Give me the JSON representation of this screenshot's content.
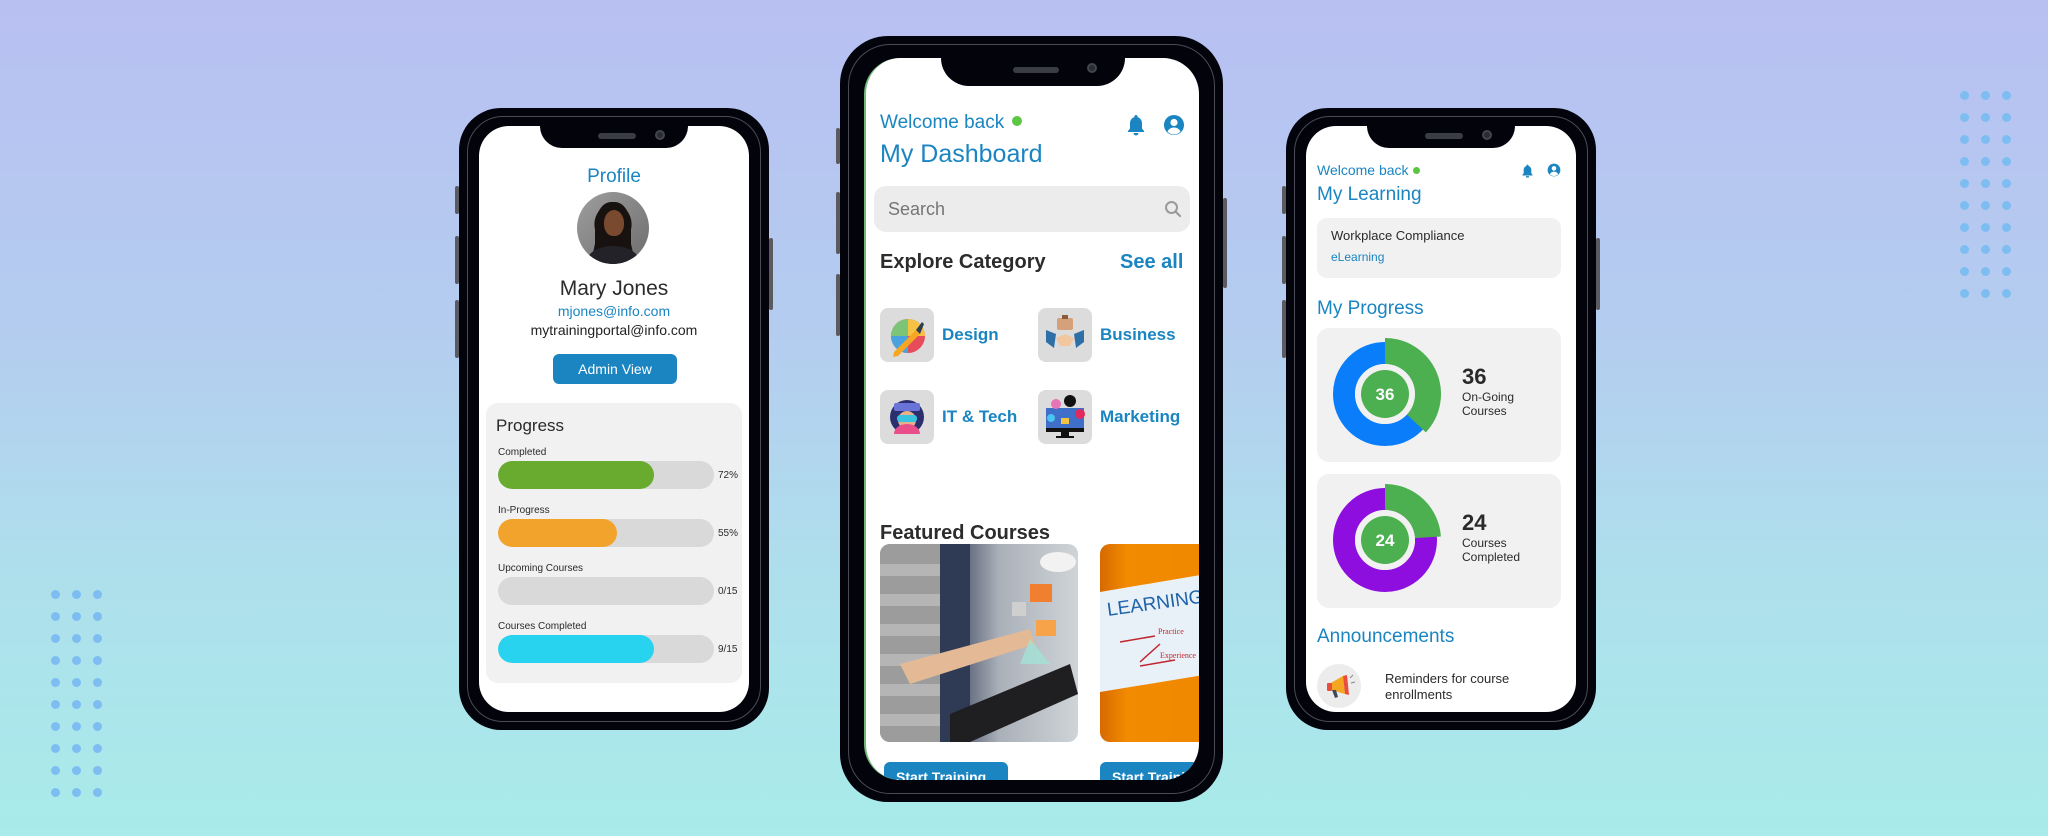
{
  "colors": {
    "accent": "#1a85c1",
    "online": "#5cc542",
    "completed": "#68ab2f",
    "in_progress": "#f2a32b",
    "upcoming": "#d9d9d9",
    "courses_completed": "#28d3f0",
    "donut_highlight": "#4caf50",
    "donut_ongoing": "#0a7dfb",
    "donut_completed": "#8e0ddf"
  },
  "profile_phone": {
    "title": "Profile",
    "name": "Mary Jones",
    "email": "mjones@info.com",
    "portal_email": "mytrainingportal@info.com",
    "admin_button": "Admin View",
    "progress": {
      "title": "Progress",
      "items": [
        {
          "label": "Completed",
          "value_text": "72%",
          "fraction": 0.72,
          "color": "#68ab2f"
        },
        {
          "label": "In-Progress",
          "value_text": "55%",
          "fraction": 0.55,
          "color": "#f2a32b"
        },
        {
          "label": "Upcoming Courses",
          "value_text": "0/15",
          "fraction": 0,
          "color": "#d9d9d9"
        },
        {
          "label": "Courses Completed",
          "value_text": "9/15",
          "fraction": 0.72,
          "color": "#28d3f0"
        }
      ]
    }
  },
  "dashboard_phone": {
    "welcome": "Welcome back",
    "title": "My Dashboard",
    "search_placeholder": "Search",
    "explore": {
      "title": "Explore Category",
      "see_all": "See all",
      "categories": [
        {
          "label": "Design",
          "icon": "pen-palette-icon"
        },
        {
          "label": "Business",
          "icon": "handshake-icon"
        },
        {
          "label": "IT & Tech",
          "icon": "vr-headset-icon"
        },
        {
          "label": "Marketing",
          "icon": "monitor-chat-icon"
        }
      ]
    },
    "featured": {
      "title": "Featured Courses",
      "courses": [
        {
          "image": "tablet-cloud-image",
          "button": "Start Training"
        },
        {
          "image": "learning-whiteboard-image",
          "button": "Start Training",
          "image_text": "LEARNING"
        }
      ]
    }
  },
  "learning_phone": {
    "welcome": "Welcome back",
    "title": "My Learning",
    "current_course": {
      "title": "Workplace Compliance",
      "type": "eLearning"
    },
    "progress_title": "My Progress",
    "stats": [
      {
        "value": "36",
        "caption": "On-Going Courses",
        "fraction": 0.37,
        "ring_color": "#0a7dfb"
      },
      {
        "value": "24",
        "caption": "Courses Completed",
        "fraction": 0.24,
        "ring_color": "#8e0ddf"
      }
    ],
    "announcements_title": "Announcements",
    "announcements": [
      {
        "text": "Reminders for course enrollments",
        "icon": "megaphone-icon"
      }
    ]
  }
}
